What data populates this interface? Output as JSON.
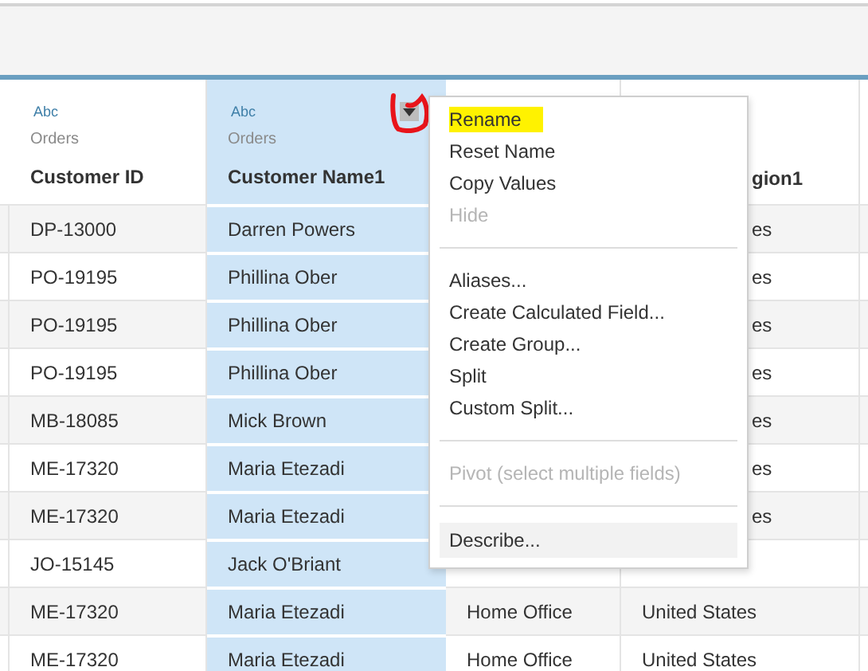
{
  "table": {
    "columns": [
      {
        "type_label": "Abc",
        "source": "Orders",
        "name": "Customer ID",
        "selected": false
      },
      {
        "type_label": "Abc",
        "source": "Orders",
        "name": "Customer Name1",
        "selected": true
      },
      {
        "selected": false
      },
      {
        "name": "gion1",
        "kind": "fragment",
        "selected": false
      }
    ],
    "rows": [
      {
        "cells": [
          {
            "text": "DP-13000"
          },
          {
            "text": "Darren Powers"
          },
          null,
          {
            "text": "es",
            "kind": "fragment"
          }
        ]
      },
      {
        "cells": [
          {
            "text": "PO-19195"
          },
          {
            "text": "Phillina Ober"
          },
          null,
          {
            "text": "es",
            "kind": "fragment"
          }
        ]
      },
      {
        "cells": [
          {
            "text": "PO-19195"
          },
          {
            "text": "Phillina Ober"
          },
          null,
          {
            "text": "es",
            "kind": "fragment"
          }
        ]
      },
      {
        "cells": [
          {
            "text": "PO-19195"
          },
          {
            "text": "Phillina Ober"
          },
          null,
          {
            "text": "es",
            "kind": "fragment"
          }
        ]
      },
      {
        "cells": [
          {
            "text": "MB-18085"
          },
          {
            "text": "Mick Brown"
          },
          null,
          {
            "text": "es",
            "kind": "fragment"
          }
        ]
      },
      {
        "cells": [
          {
            "text": "ME-17320"
          },
          {
            "text": "Maria Etezadi"
          },
          null,
          {
            "text": "es",
            "kind": "fragment"
          }
        ]
      },
      {
        "cells": [
          {
            "text": "ME-17320"
          },
          {
            "text": "Maria Etezadi"
          },
          null,
          {
            "text": "es",
            "kind": "fragment"
          }
        ]
      },
      {
        "cells": [
          {
            "text": "JO-15145"
          },
          {
            "text": "Jack O'Briant"
          }
        ]
      },
      {
        "cells": [
          {
            "text": "ME-17320"
          },
          {
            "text": "Maria Etezadi"
          },
          {
            "text": "Home Office"
          },
          {
            "text": "United States"
          }
        ]
      },
      {
        "cells": [
          {
            "text": "ME-17320"
          },
          {
            "text": "Maria Etezadi"
          },
          {
            "text": "Home Office"
          },
          {
            "text": "United States"
          }
        ]
      }
    ]
  },
  "context_menu": {
    "items": [
      {
        "kind": "item",
        "label": "Rename",
        "disabled": false,
        "highlighted": true,
        "hovered": false
      },
      {
        "kind": "item",
        "label": "Reset Name",
        "disabled": false,
        "highlighted": false,
        "hovered": false
      },
      {
        "kind": "item",
        "label": "Copy Values",
        "disabled": false,
        "highlighted": false,
        "hovered": false
      },
      {
        "kind": "item",
        "label": "Hide",
        "disabled": true,
        "highlighted": false,
        "hovered": false
      },
      {
        "kind": "separator"
      },
      {
        "kind": "item",
        "label": "Aliases...",
        "disabled": false,
        "highlighted": false,
        "hovered": false
      },
      {
        "kind": "item",
        "label": "Create Calculated Field...",
        "disabled": false,
        "highlighted": false,
        "hovered": false
      },
      {
        "kind": "item",
        "label": "Create Group...",
        "disabled": false,
        "highlighted": false,
        "hovered": false
      },
      {
        "kind": "item",
        "label": "Split",
        "disabled": false,
        "highlighted": false,
        "hovered": false
      },
      {
        "kind": "item",
        "label": "Custom Split...",
        "disabled": false,
        "highlighted": false,
        "hovered": false
      },
      {
        "kind": "separator"
      },
      {
        "kind": "item",
        "label": "Pivot (select multiple fields)",
        "disabled": true,
        "highlighted": false,
        "hovered": false
      },
      {
        "kind": "separator"
      },
      {
        "kind": "item",
        "label": "Describe...",
        "disabled": false,
        "highlighted": false,
        "hovered": true
      }
    ]
  }
}
